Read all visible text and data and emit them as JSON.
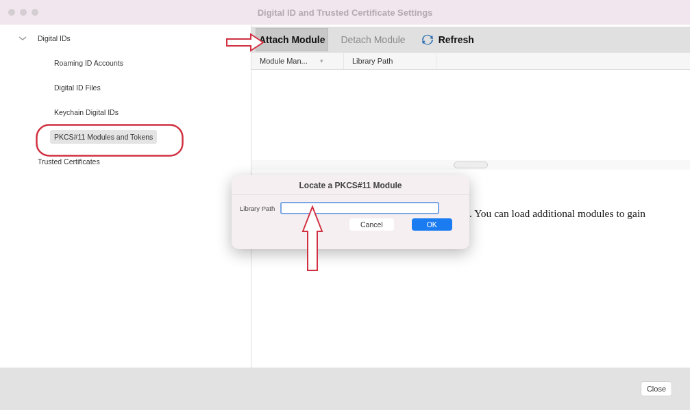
{
  "window": {
    "title": "Digital ID and Trusted Certificate Settings"
  },
  "sidebar": {
    "items": [
      {
        "label": "Digital IDs",
        "expanded": true,
        "selected": false,
        "children": [
          {
            "label": "Roaming ID Accounts",
            "selected": false
          },
          {
            "label": "Digital ID Files",
            "selected": false
          },
          {
            "label": "Keychain Digital IDs",
            "selected": false
          },
          {
            "label": "PKCS#11 Modules and Tokens",
            "selected": true
          }
        ]
      },
      {
        "label": "Trusted Certificates",
        "selected": false
      }
    ]
  },
  "toolbar": [
    {
      "label": "Attach Module",
      "kind": "pressed",
      "disabled": false
    },
    {
      "label": "Detach Module",
      "kind": "plain",
      "disabled": true
    },
    {
      "label": "Refresh",
      "kind": "icon",
      "disabled": false
    }
  ],
  "table": {
    "columns": [
      {
        "label": "Module Man...",
        "sort_mark": "▾"
      },
      {
        "label": "Library Path"
      }
    ]
  },
  "body_text": ". You can load additional modules to gain",
  "dialog": {
    "title": "Locate a PKCS#11 Module",
    "field_label": "Library Path",
    "buttons": [
      {
        "label": "Cancel",
        "kind": "secondary"
      },
      {
        "label": "OK",
        "kind": "primary"
      }
    ]
  },
  "footer": {
    "close": "Close"
  }
}
